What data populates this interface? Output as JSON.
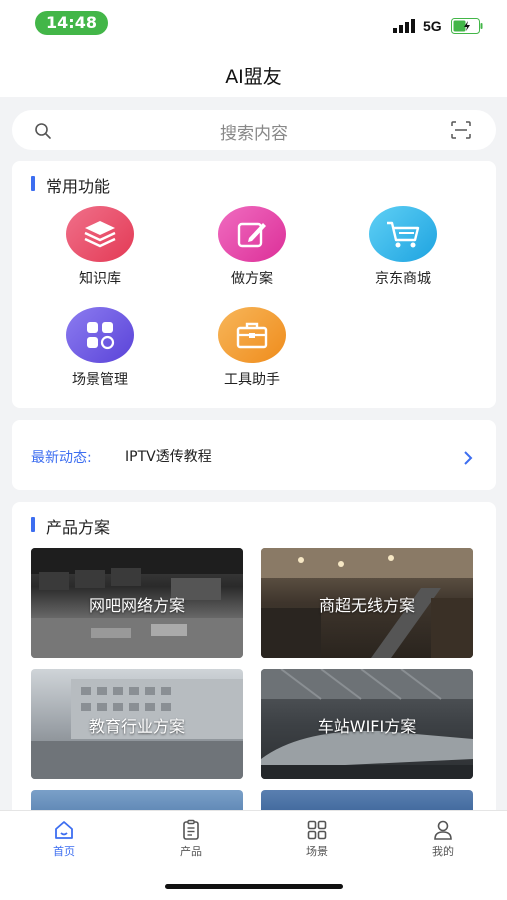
{
  "status_bar": {
    "time": "14:48",
    "network": "5G"
  },
  "app": {
    "title": "AI盟友"
  },
  "search": {
    "placeholder": "搜索内容"
  },
  "common_functions": {
    "title": "常用功能",
    "items": [
      {
        "label": "知识库",
        "icon": "layers-icon",
        "color": "#e94b64"
      },
      {
        "label": "做方案",
        "icon": "edit-icon",
        "color": "#e43fa6"
      },
      {
        "label": "京东商城",
        "icon": "cart-icon",
        "color": "#2fb4e8"
      },
      {
        "label": "场景管理",
        "icon": "scene-grid-icon",
        "color": "#6a55e0"
      },
      {
        "label": "工具助手",
        "icon": "toolbox-icon",
        "color": "#f29a2a"
      }
    ]
  },
  "news": {
    "label": "最新动态:",
    "text": "IPTV透传教程"
  },
  "product_solutions": {
    "title": "产品方案",
    "items": [
      {
        "label": "网吧网络方案"
      },
      {
        "label": "商超无线方案"
      },
      {
        "label": "教育行业方案"
      },
      {
        "label": "车站WIFI方案"
      }
    ]
  },
  "tabbar": {
    "items": [
      {
        "label": "首页",
        "icon": "home-icon",
        "active": true
      },
      {
        "label": "产品",
        "icon": "clipboard-icon",
        "active": false
      },
      {
        "label": "场景",
        "icon": "grid-icon",
        "active": false
      },
      {
        "label": "我的",
        "icon": "user-icon",
        "active": false
      }
    ]
  },
  "colors": {
    "accent": "#3d6ef0",
    "status_green": "#43b648",
    "background": "#f2f3f5"
  }
}
